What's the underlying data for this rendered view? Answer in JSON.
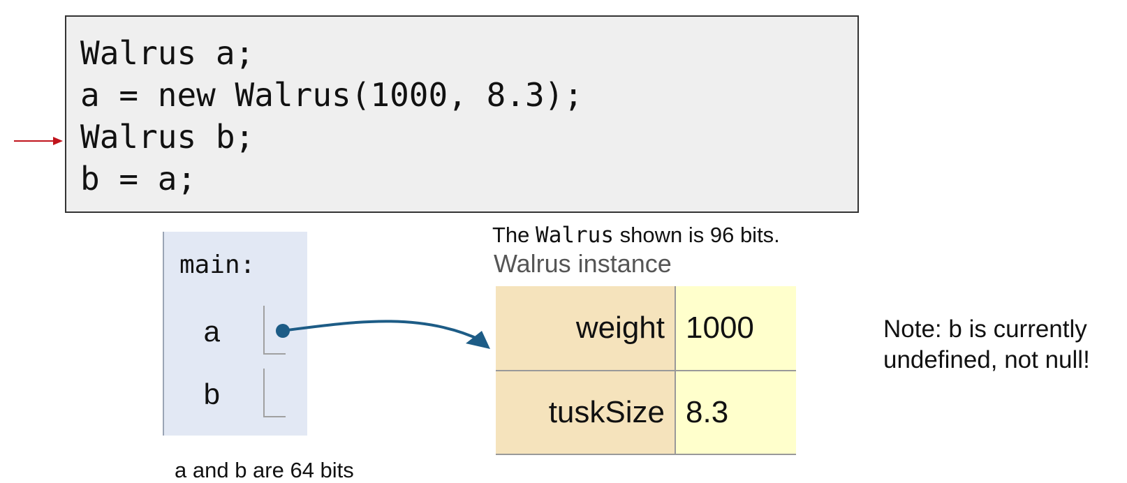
{
  "code": {
    "lines": [
      "Walrus a;",
      "a = new Walrus(1000, 8.3);",
      "Walrus b;",
      "b = a;"
    ],
    "current_line_index": 2
  },
  "frame": {
    "title": "main:",
    "variables": [
      {
        "name": "a"
      },
      {
        "name": "b"
      }
    ]
  },
  "size_note": {
    "prefix": "The ",
    "type_name": "Walrus",
    "suffix": " shown is 96 bits."
  },
  "instance": {
    "label": "Walrus instance",
    "fields": [
      {
        "name": "weight",
        "value": "1000"
      },
      {
        "name": "tuskSize",
        "value": "8.3"
      }
    ]
  },
  "bits_note": "a and b are 64 bits",
  "side_note": {
    "line1": "Note: b is currently",
    "line2": "undefined, not null!"
  },
  "colors": {
    "pointer_arrow": "#c0141c",
    "reference_arrow": "#1d5c86",
    "frame_bg": "#e2e8f4",
    "field_bg": "#f5e3bc",
    "value_bg": "#ffffcc"
  },
  "icons": {
    "current_line_pointer": "right-arrow-icon",
    "reference": "curved-arrow-icon"
  }
}
